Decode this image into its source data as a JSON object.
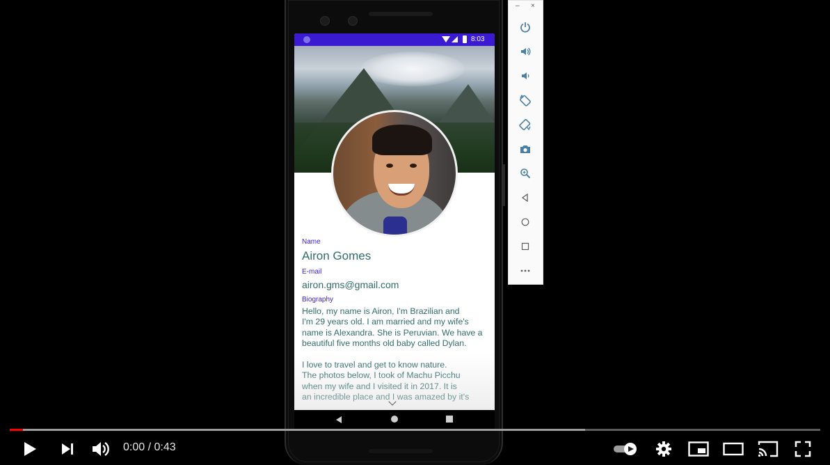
{
  "status_bar": {
    "time": "8:03"
  },
  "profile": {
    "name_label": "Name",
    "name": "Airon Gomes",
    "email_label": "E-mail",
    "email": "airon.gms@gmail.com",
    "bio_label": "Biography",
    "bio": "Hello, my name is Airon, I'm Brazilian and\nI'm 29 years old. I am married and my wife's\nname is Alexandra. She is Peruvian. We have a\nbeautiful five months old baby called Dylan.\n\n I love to travel and get to know nature.\nThe photos below, I took of Machu Picchu\nwhen my wife and I visited it in 2017. It is\nan incredible place and I was amazed by it's"
  },
  "emulator_toolbar": {
    "minimize": "–",
    "close": "×",
    "icons": [
      "power-icon",
      "volume-up-icon",
      "volume-down-icon",
      "rotate-left-icon",
      "rotate-right-icon",
      "camera-icon",
      "zoom-icon",
      "back-icon",
      "home-icon",
      "overview-icon",
      "more-icon"
    ]
  },
  "player": {
    "time": "0:00 / 0:43",
    "progress": 0.016,
    "buffered": 0.71,
    "colors": {
      "played": "#ff0000",
      "accent": "#3a1bd2"
    }
  }
}
